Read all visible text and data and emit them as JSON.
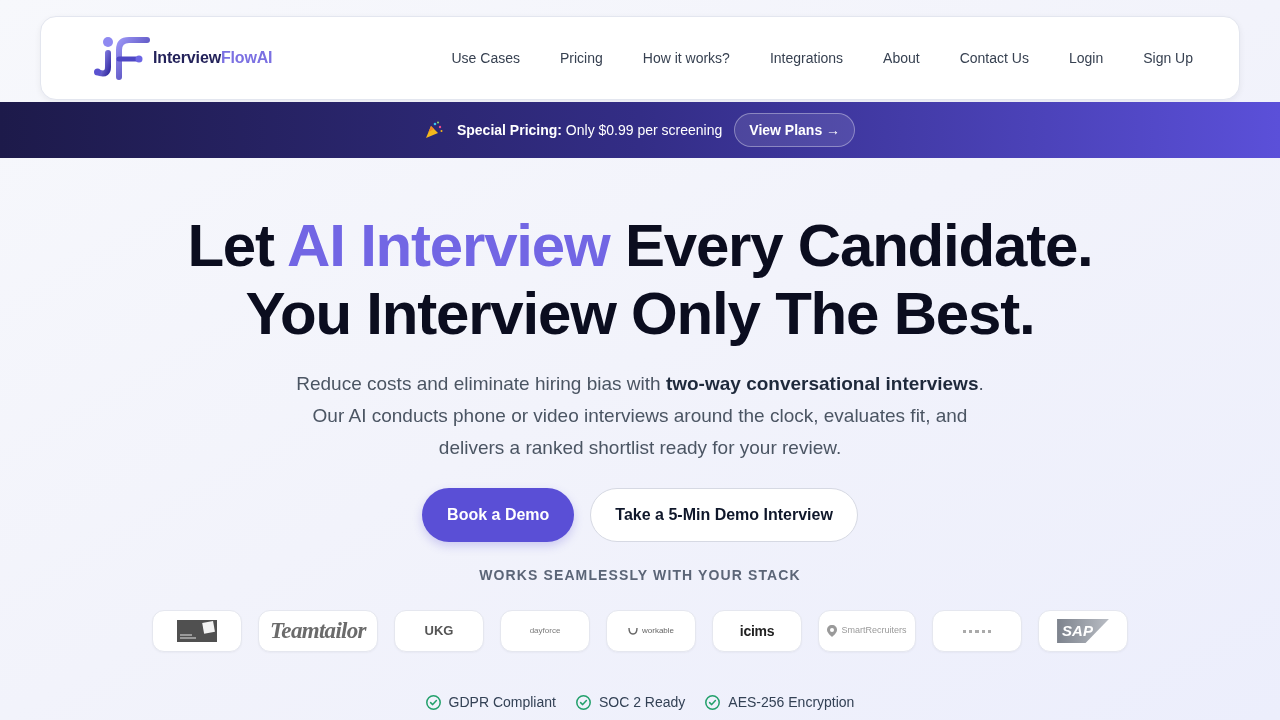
{
  "header": {
    "logo": {
      "parts": [
        {
          "text": "Interview",
          "accent": false
        },
        {
          "text": "FlowAI",
          "accent": true
        }
      ]
    },
    "nav": [
      "Use Cases",
      "Pricing",
      "How it works?",
      "Integrations",
      "About",
      "Contact Us",
      "Login",
      "Sign Up"
    ]
  },
  "promo_banner": {
    "text": "**Special Pricing:** Only $0.99 per screening",
    "button": "View Plans →"
  },
  "hero": {
    "headline": {
      "lines": [
        {
          "parts": [
            {
              "text": "Let",
              "highlight": false
            },
            {
              "text": "AI Interview",
              "highlight": true
            },
            {
              "text": "Every Candidate.",
              "highlight": false
            }
          ]
        },
        {
          "parts": [
            {
              "text": "You Interview Only The Best.",
              "highlight": false
            }
          ]
        }
      ]
    },
    "subtitle": [
      "Reduce costs and eliminate hiring bias with **two-way conversational interviews**.",
      "Our AI conducts phone or video interviews around the clock, evaluates fit, and delivers a ranked shortlist ready for your review."
    ],
    "buttons": [
      {
        "label": "Book a Demo",
        "kind": "primary"
      },
      {
        "label": "Take a 5-Min Demo Interview",
        "kind": "secondary"
      }
    ]
  },
  "integrations": {
    "heading": "WORKS SEAMLESSLY WITH YOUR STACK",
    "logos": [
      {
        "kind": "card"
      },
      {
        "kind": "script",
        "name": "Teamtailor"
      },
      {
        "kind": "caps",
        "name": "UKG"
      },
      {
        "kind": "tiny",
        "name": "dayforce"
      },
      {
        "kind": "arc",
        "name": "workable"
      },
      {
        "kind": "bold",
        "name": "icims"
      },
      {
        "kind": "pin",
        "name": "SmartRecruiters"
      },
      {
        "kind": "dots"
      },
      {
        "kind": "badge",
        "name": "SAP"
      }
    ]
  },
  "trust_badges": [
    {
      "label": "GDPR Compliant"
    },
    {
      "label": "SOC 2 Ready"
    },
    {
      "label": "AES-256 Encryption"
    }
  ]
}
